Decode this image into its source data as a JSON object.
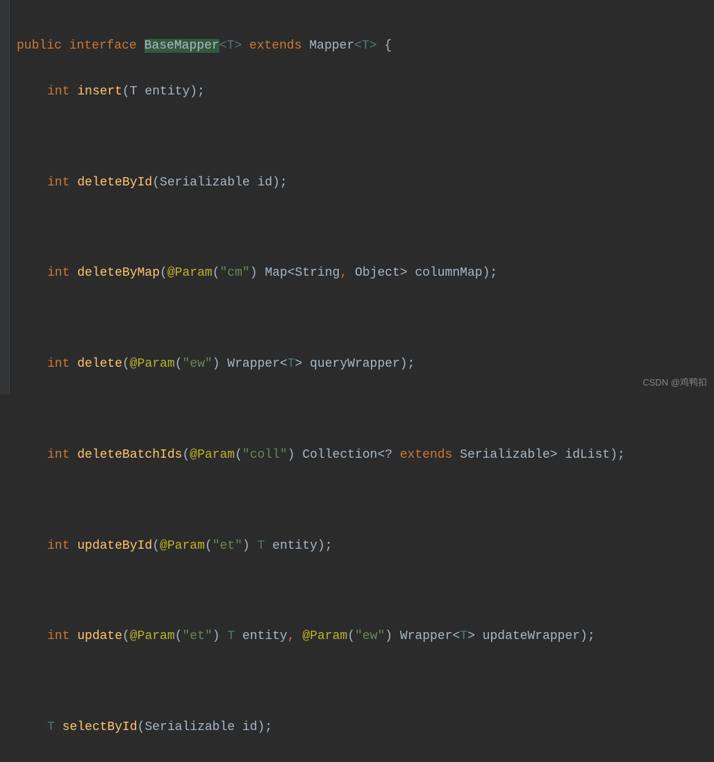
{
  "code": {
    "line1": {
      "public": "public",
      "interface": "interface",
      "className": "BaseMapper",
      "generic1": "<T>",
      "extends": "extends",
      "parent": "Mapper",
      "generic2": "<T>",
      "brace": " {"
    },
    "line2": {
      "returnType": "int",
      "method": "insert",
      "params": "(T entity);"
    },
    "line3": {
      "returnType": "int",
      "method": "deleteById",
      "params": "(Serializable id);"
    },
    "line4": {
      "returnType": "int",
      "method": "deleteByMap",
      "open": "(",
      "anno": "@Param",
      "annoOpen": "(",
      "str": "\"cm\"",
      "annoClose": ")",
      "rest1": " Map<String",
      "comma": ",",
      "rest2": " Object> columnMap);"
    },
    "line5": {
      "returnType": "int",
      "method": "delete",
      "open": "(",
      "anno": "@Param",
      "annoOpen": "(",
      "str": "\"ew\"",
      "annoClose": ")",
      "rest1": " Wrapper<",
      "generic": "T",
      "rest2": "> queryWrapper);"
    },
    "line6": {
      "returnType": "int",
      "method": "deleteBatchIds",
      "open": "(",
      "anno": "@Param",
      "annoOpen": "(",
      "str": "\"coll\"",
      "annoClose": ")",
      "rest1": " Collection<? ",
      "extends": "extends",
      "rest2": " Serializable> idList);"
    },
    "line7": {
      "returnType": "int",
      "method": "updateById",
      "open": "(",
      "anno": "@Param",
      "annoOpen": "(",
      "str": "\"et\"",
      "annoClose": ")",
      "rest1": " ",
      "generic": "T",
      "rest2": " entity);"
    },
    "line8": {
      "returnType": "int",
      "method": "update",
      "open": "(",
      "anno1": "@Param",
      "anno1Open": "(",
      "str1": "\"et\"",
      "anno1Close": ")",
      "sp1": " ",
      "generic1": "T",
      "mid": " entity",
      "comma": ",",
      "sp2": " ",
      "anno2": "@Param",
      "anno2Open": "(",
      "str2": "\"ew\"",
      "anno2Close": ")",
      "rest1": " Wrapper<",
      "generic2": "T",
      "rest2": "> updateWrapper);"
    },
    "line9": {
      "returnType": "T",
      "method": "selectById",
      "params": "(Serializable id);"
    }
  },
  "watermark": "CSDN @鸡鸭扣"
}
